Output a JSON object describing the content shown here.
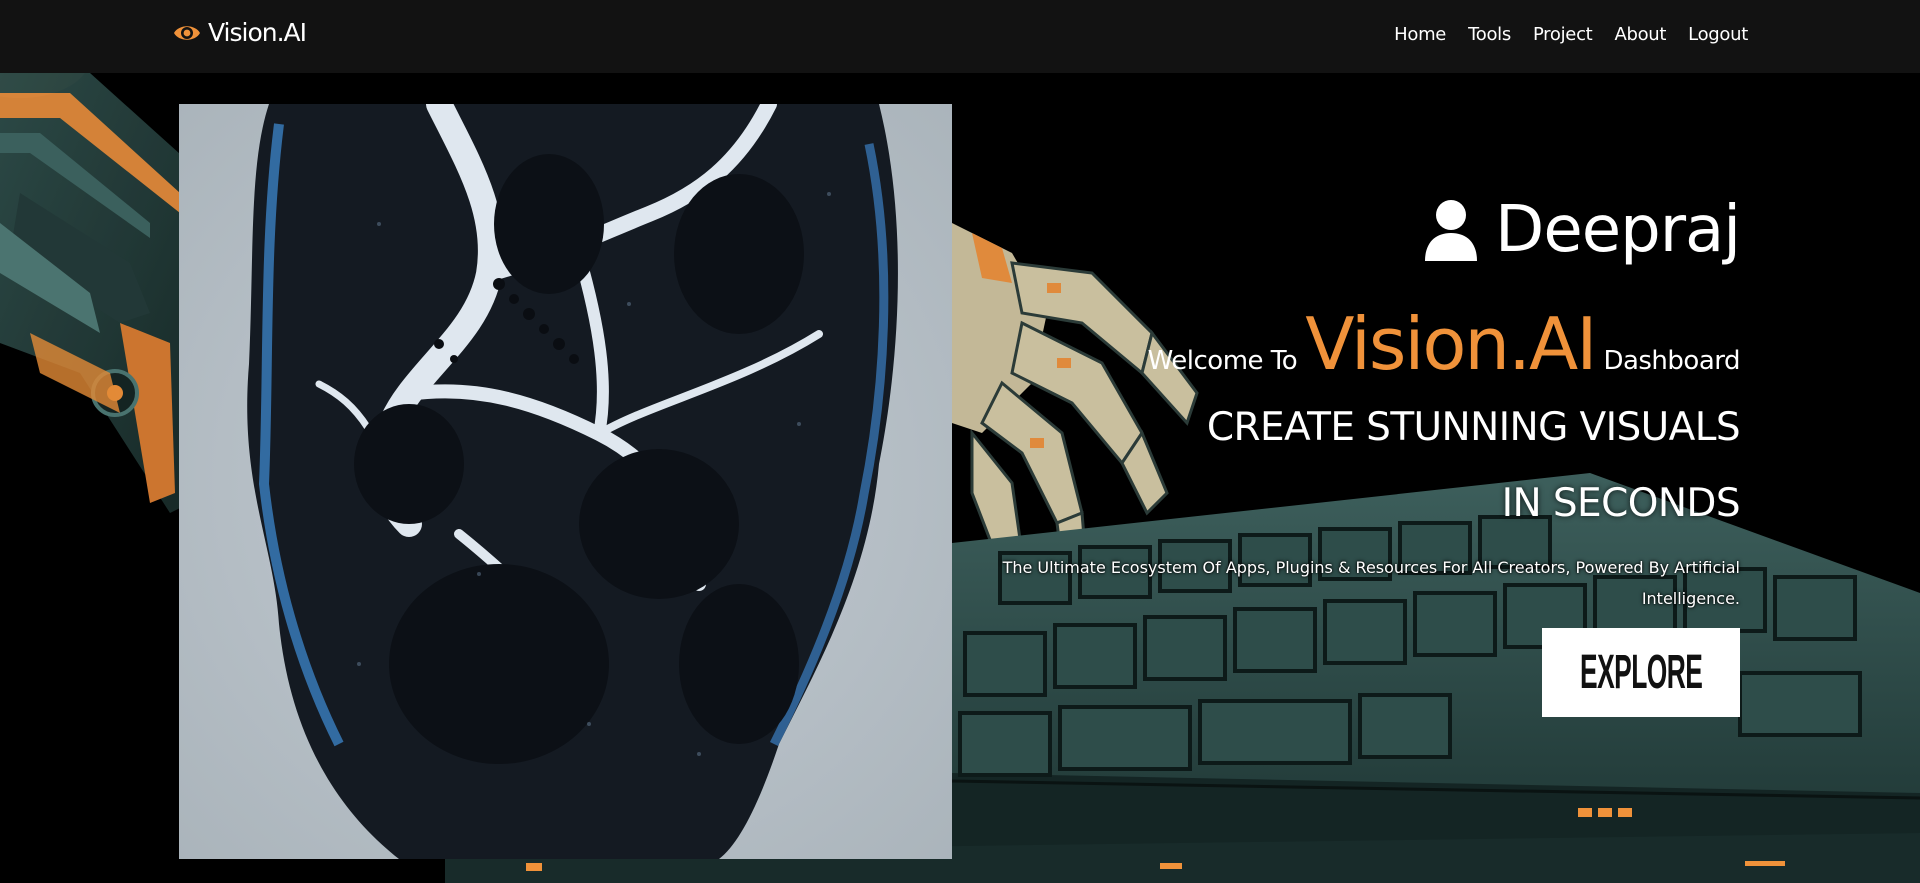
{
  "brand": {
    "name": "Vision.AI",
    "icon": "eye-icon",
    "accent": "#f0923a"
  },
  "nav": {
    "items": [
      {
        "label": "Home"
      },
      {
        "label": "Tools"
      },
      {
        "label": "Project"
      },
      {
        "label": "About"
      },
      {
        "label": "Logout"
      }
    ]
  },
  "hero": {
    "user_icon": "user-icon",
    "user_name": "Deepraj",
    "welcome_prefix": "Welcome To",
    "welcome_brand": "Vision.AI",
    "welcome_suffix": "Dashboard",
    "headline_1": "CREATE STUNNING VISUALS",
    "headline_2": "IN SECONDS",
    "tagline": "The Ultimate Ecosystem Of Apps, Plugins & Resources For All Creators, Powered By Artificial Intelligence.",
    "cta_label": "EXPLORE"
  },
  "colors": {
    "navbar_bg": "#121212",
    "page_bg": "#000000",
    "accent": "#f0923a",
    "button_bg": "#ffffff"
  }
}
